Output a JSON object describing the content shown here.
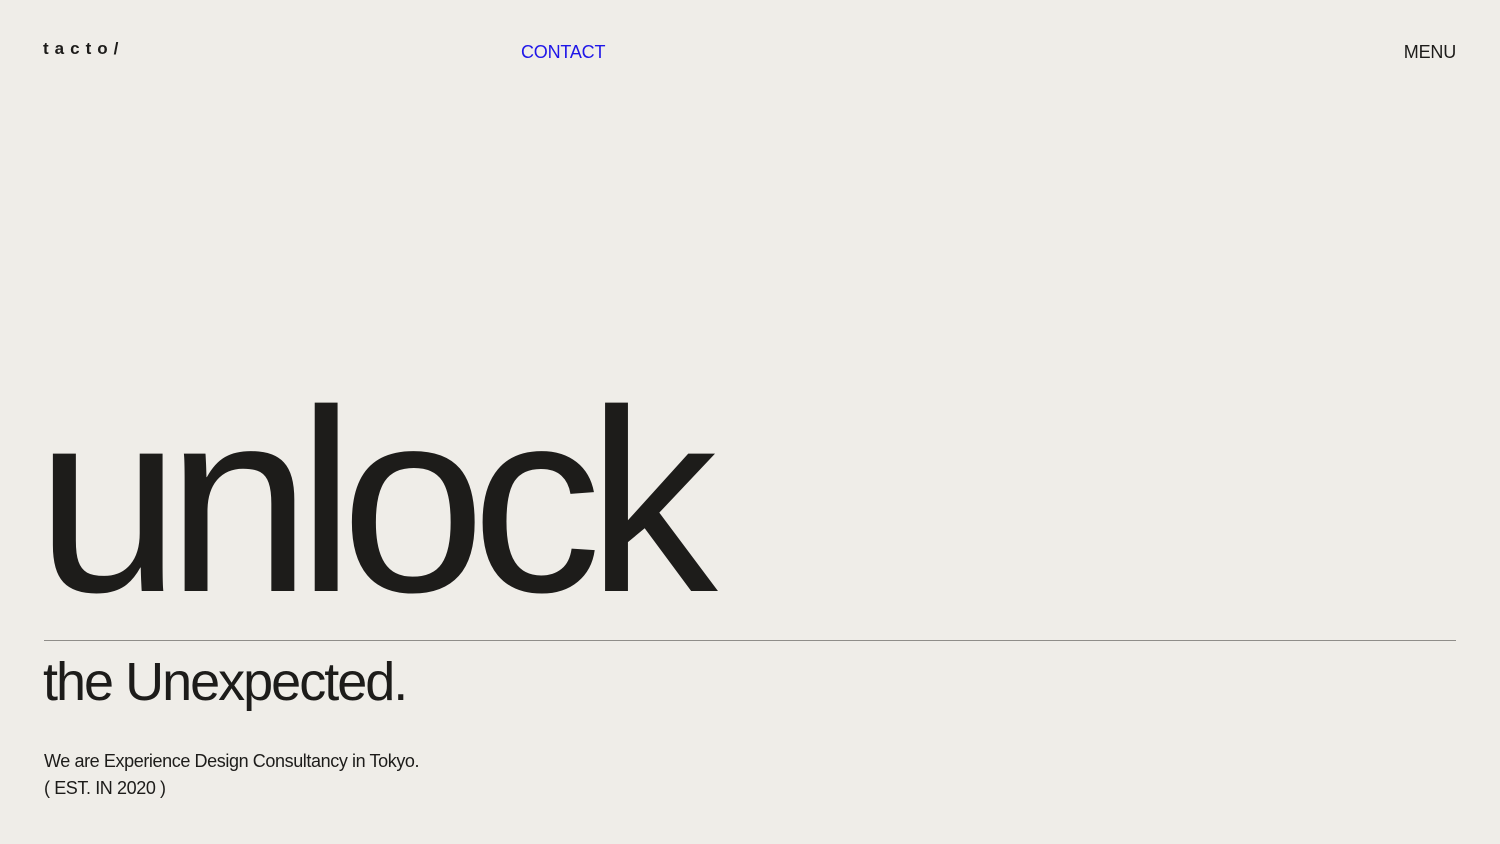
{
  "header": {
    "logo": "tacto/",
    "contact_label": "CONTACT",
    "menu_label": "MENU"
  },
  "hero": {
    "headline": "unlock",
    "subheadline": "the Unexpected.",
    "description_line1": "We are Experience Design Consultancy in Tokyo.",
    "description_line2": "( EST. IN 2020 )"
  },
  "colors": {
    "background": "#efede8",
    "text": "#1d1c1a",
    "accent": "#1f16e8",
    "rule": "#8f8d89"
  }
}
